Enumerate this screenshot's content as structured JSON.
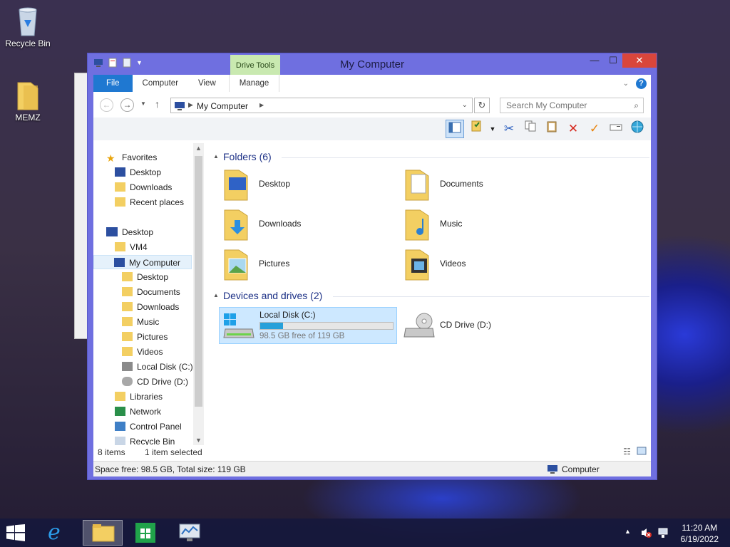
{
  "desktop": {
    "icons": [
      {
        "label": "Recycle Bin"
      },
      {
        "label": "MEMZ"
      }
    ]
  },
  "window": {
    "title": "My Computer",
    "contextual_tab": "Drive Tools",
    "tabs": [
      "File",
      "Computer",
      "View",
      "Manage"
    ],
    "address": "My Computer",
    "search_placeholder": "Search My Computer"
  },
  "nav": {
    "favorites": "Favorites",
    "fav_items": [
      "Desktop",
      "Downloads",
      "Recent places"
    ],
    "desktop": "Desktop",
    "vm": "VM4",
    "my_computer": "My Computer",
    "computer_items": [
      "Desktop",
      "Documents",
      "Downloads",
      "Music",
      "Pictures",
      "Videos",
      "Local Disk (C:)",
      "CD Drive (D:)"
    ],
    "other_items": [
      "Libraries",
      "Network",
      "Control Panel",
      "Recycle Bin"
    ]
  },
  "content": {
    "folders_header": "Folders (6)",
    "folders": [
      "Desktop",
      "Documents",
      "Downloads",
      "Music",
      "Pictures",
      "Videos"
    ],
    "devices_header": "Devices and drives (2)",
    "drives": [
      {
        "name": "Local Disk (C:)",
        "free_text": "98.5 GB free of 119 GB",
        "used_fraction": 0.17
      },
      {
        "name": "CD Drive (D:)"
      }
    ]
  },
  "status": {
    "items": "8 items",
    "selected": "1 item selected",
    "space": "Space free: 98.5 GB, Total size: 119 GB",
    "location": "Computer"
  },
  "taskbar": {
    "time": "11:20 AM",
    "date": "6/19/2022"
  },
  "colors": {
    "window_frame": "#6f6fe0",
    "file_tab": "#1f78d1",
    "drive_tools": "#c9e9b0",
    "progress": "#26a0da"
  }
}
